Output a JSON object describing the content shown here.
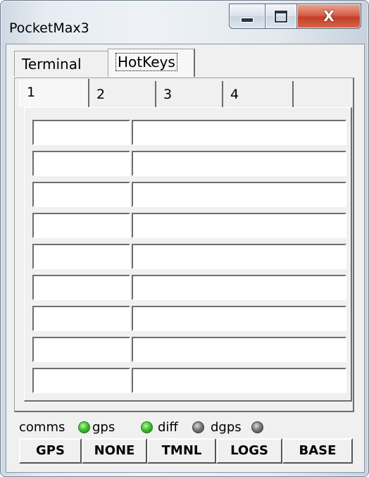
{
  "window": {
    "title": "PocketMax3"
  },
  "outer_tabs": [
    {
      "label": "Terminal",
      "selected": false
    },
    {
      "label": "HotKeys",
      "selected": true
    }
  ],
  "inner_tabs": [
    {
      "label": "1",
      "selected": true
    },
    {
      "label": "2",
      "selected": false
    },
    {
      "label": "3",
      "selected": false
    },
    {
      "label": "4",
      "selected": false
    }
  ],
  "hotkeys": [
    {
      "key": "",
      "command": ""
    },
    {
      "key": "",
      "command": ""
    },
    {
      "key": "",
      "command": ""
    },
    {
      "key": "",
      "command": ""
    },
    {
      "key": "",
      "command": ""
    },
    {
      "key": "",
      "command": ""
    },
    {
      "key": "",
      "command": ""
    },
    {
      "key": "",
      "command": ""
    },
    {
      "key": "",
      "command": ""
    }
  ],
  "status": {
    "comms": {
      "label": "comms",
      "color": "#3dc531"
    },
    "gps": {
      "label": "gps",
      "color": "#3dc531"
    },
    "diff": {
      "label": "diff",
      "color": "#7c7c7c"
    },
    "dgps": {
      "label": "dgps",
      "color": "#7c7c7c"
    }
  },
  "buttons": [
    {
      "label": "GPS"
    },
    {
      "label": "NONE"
    },
    {
      "label": "TMNL"
    },
    {
      "label": "LOGS"
    },
    {
      "label": "BASE"
    }
  ],
  "icons": {
    "minimize": "minimize-icon",
    "maximize": "maximize-icon",
    "close": "close-icon"
  },
  "colors": {
    "close_button": "#c43e25",
    "led_on": "#3dc531",
    "led_off": "#7c7c7c"
  }
}
